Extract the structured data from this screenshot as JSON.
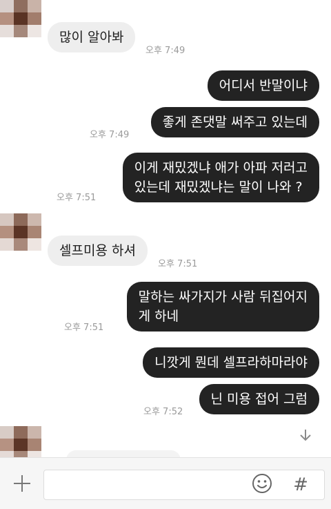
{
  "messages": [
    {
      "direction": "in",
      "text": "많이 알아봐",
      "time": "오후 7:49"
    },
    {
      "direction": "out",
      "text": "어디서 반말이냐"
    },
    {
      "direction": "out",
      "text": "좋게 존댓말 써주고 있는데",
      "time": "오후 7:49"
    },
    {
      "direction": "out",
      "text": "이게 재밌겠냐  애가 아파 저러고\n있는데 재밌겠냐는 말이 나와 ?",
      "time": "오후 7:51"
    },
    {
      "direction": "in",
      "text": "셀프미용 하셔",
      "time": "오후 7:51"
    },
    {
      "direction": "out",
      "text": "말하는 싸가지가 사람 뒤집어지\n게 하네",
      "time": "오후 7:51"
    },
    {
      "direction": "out",
      "text": "니깟게 뭔데 셀프라하마라야"
    },
    {
      "direction": "out",
      "text": "닌 미용 접어 그럼",
      "time": "오후 7:52"
    }
  ],
  "composer": {
    "input_value": "",
    "hash_label": "#"
  },
  "icons": {
    "attach": "plus-icon",
    "emoji": "smiley-icon",
    "scroll": "arrow-down-icon"
  },
  "colors": {
    "incoming_bubble": "#eeeeee",
    "outgoing_bubble": "#232323",
    "timestamp": "#9a9a9a",
    "background": "#ffffff"
  }
}
